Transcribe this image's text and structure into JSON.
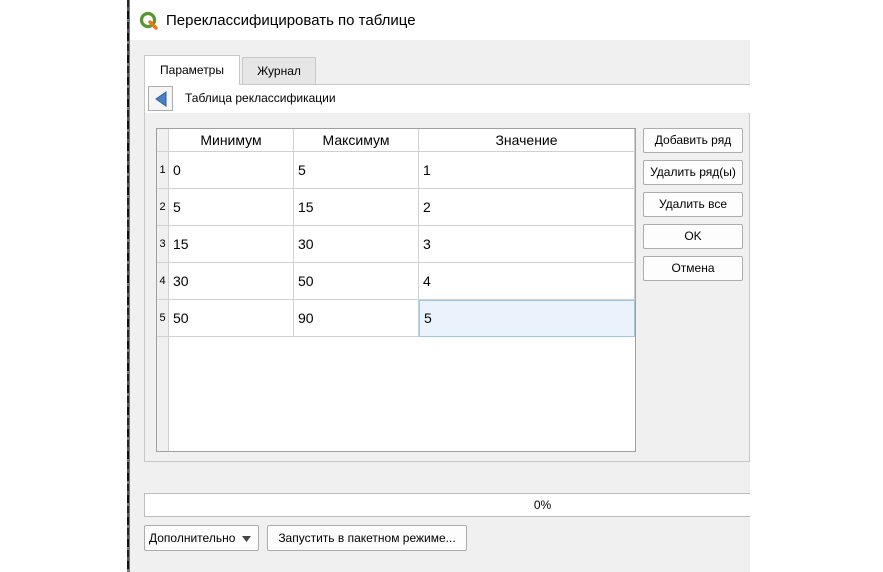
{
  "window": {
    "title": "Переклассифицировать по таблице"
  },
  "tabs": [
    {
      "label": "Параметры"
    },
    {
      "label": "Журнал"
    }
  ],
  "panel": {
    "section_title": "Таблица реклассификации"
  },
  "table": {
    "columns": [
      "Минимум",
      "Максимум",
      "Значение"
    ],
    "rows": [
      {
        "index": "1",
        "min": "0",
        "max": "5",
        "value": "1"
      },
      {
        "index": "2",
        "min": "5",
        "max": "15",
        "value": "2"
      },
      {
        "index": "3",
        "min": "15",
        "max": "30",
        "value": "3"
      },
      {
        "index": "4",
        "min": "30",
        "max": "50",
        "value": "4"
      },
      {
        "index": "5",
        "min": "50",
        "max": "90",
        "value": "5"
      }
    ],
    "selected_cell": "row 5, Значение"
  },
  "side_buttons": {
    "add_row": "Добавить ряд",
    "remove_rows": "Удалить ряд(ы)",
    "remove_all": "Удалить все",
    "ok": "OK",
    "cancel": "Отмена"
  },
  "progress": {
    "text": "0%",
    "value": 0
  },
  "bottom": {
    "advanced": "Дополнительно",
    "batch": "Запустить в пакетном режиме..."
  },
  "colors": {
    "accent": "#4a7fc1",
    "qgis_green": "#589632",
    "selection": "#eaf3fb"
  },
  "icons": {
    "app": "qgis-logo-icon",
    "back": "back-arrow-icon",
    "dropdown": "chevron-down-icon"
  }
}
